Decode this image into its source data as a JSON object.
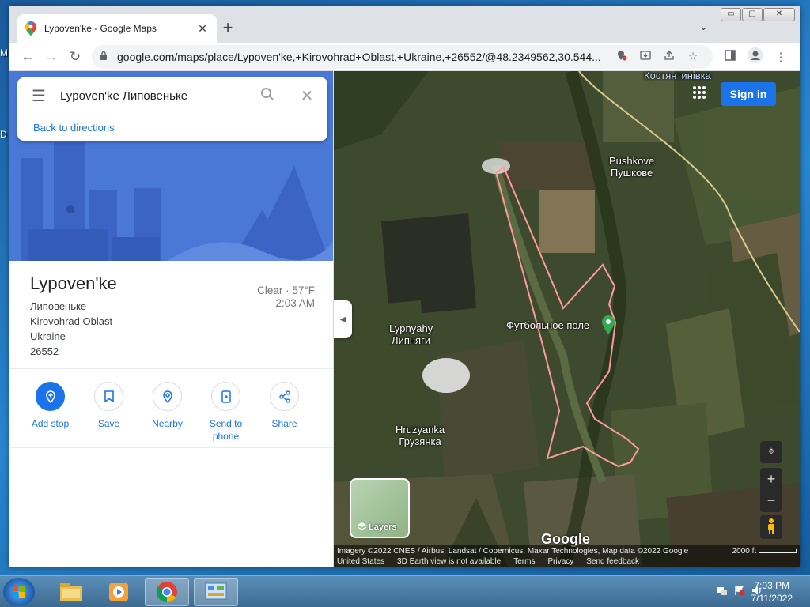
{
  "desktop": {
    "left_labels": [
      "M",
      "D"
    ]
  },
  "browser": {
    "tab_title": "Lypoven'ke - Google Maps",
    "tab_close": "✕",
    "new_tab": "+",
    "tab_search": "⌄",
    "window_buttons": [
      "▭",
      "▢",
      "✕"
    ],
    "url": "google.com/maps/place/Lypoven'ke,+Kirovohrad+Oblast,+Ukraine,+26552/@48.2349562,30.544...",
    "nav": {
      "back": "←",
      "forward": "→",
      "reload": "↻"
    }
  },
  "search": {
    "menu_icon": "☰",
    "query": "Lypoven'ke Липовеньке",
    "search_icon": "⌕",
    "close_icon": "✕",
    "back_link": "Back to directions"
  },
  "place": {
    "name": "Lypoven'ke",
    "address": [
      "Липовеньке",
      "Kirovohrad Oblast",
      "Ukraine",
      "26552"
    ],
    "weather": "Clear · 57°F",
    "time": "2:03 AM"
  },
  "actions": [
    {
      "label": "Add stop",
      "icon": "✚"
    },
    {
      "label": "Save",
      "icon": "🔖"
    },
    {
      "label": "Nearby",
      "icon": "◎"
    },
    {
      "label": "Send to phone",
      "icon": "▯"
    },
    {
      "label": "Share",
      "icon": "⋖"
    }
  ],
  "map": {
    "labels": {
      "kostiantynivka": "Костянтинівка",
      "pushkove_en": "Pushkove",
      "pushkove_uk": "Пушкове",
      "lypnyahy_en": "Lypnyahy",
      "lypnyahy_uk": "Липняги",
      "football": "Футбольное поле",
      "hruzyanka_en": "Hruzyanka",
      "hruzyanka_uk": "Грузянка"
    },
    "sign_in": "Sign in",
    "apps_icon": "⋮⋮⋮",
    "layers_label": "Layers",
    "google_logo": "Google",
    "attribution_line1": "Imagery ©2022 CNES / Airbus, Landsat / Copernicus, Maxar Technologies, Map data ©2022 Google",
    "scale": "2000 ft",
    "attribution_links": [
      "United States",
      "3D Earth view is not available",
      "Terms",
      "Privacy",
      "Send feedback"
    ],
    "controls": {
      "location": "⌖",
      "zoom_in": "+",
      "zoom_out": "−"
    }
  },
  "taskbar": {
    "time": "7:03 PM",
    "date": "7/11/2022"
  },
  "colors": {
    "accent": "#1a73e8",
    "boundary": "#ff9a9a"
  }
}
